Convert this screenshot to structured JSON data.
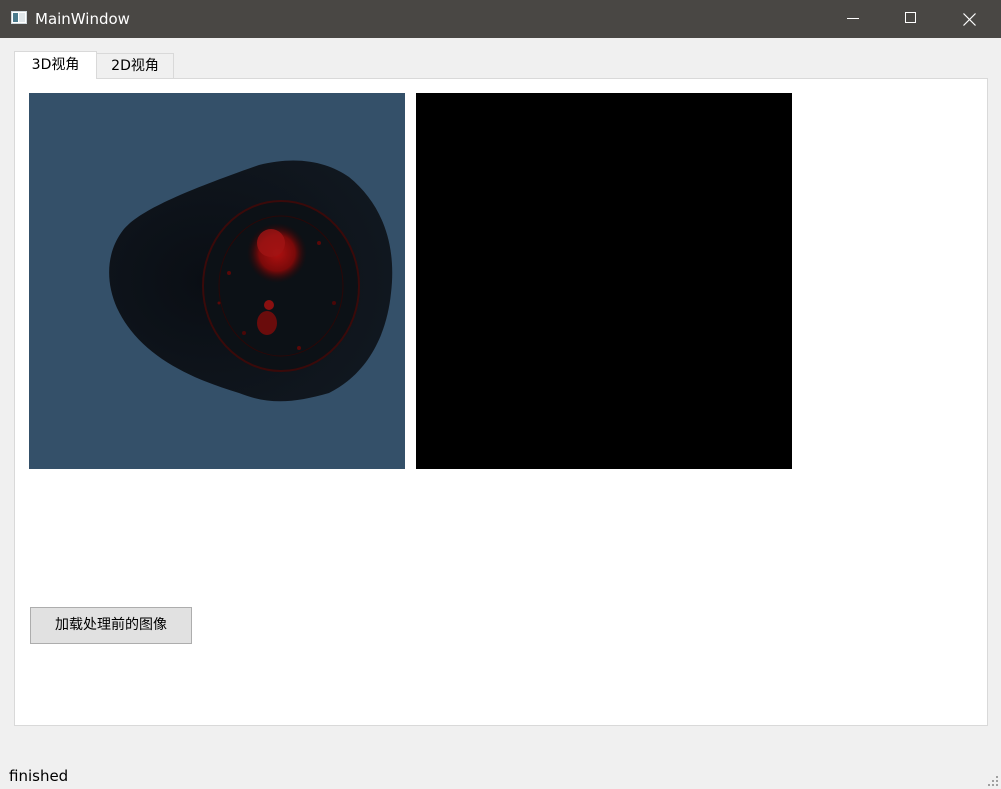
{
  "window": {
    "title": "MainWindow",
    "icon": "window-app-icon",
    "controls": [
      "minimize-icon",
      "maximize-icon",
      "close-icon"
    ]
  },
  "tabs": [
    {
      "label": "3D视角",
      "active": true
    },
    {
      "label": "2D视角",
      "active": false
    }
  ],
  "views": {
    "left": {
      "background": "#345069"
    },
    "right": {
      "background": "#000000"
    }
  },
  "buttons": {
    "load_label": "加载处理前的图像"
  },
  "status": {
    "text": "finished"
  }
}
